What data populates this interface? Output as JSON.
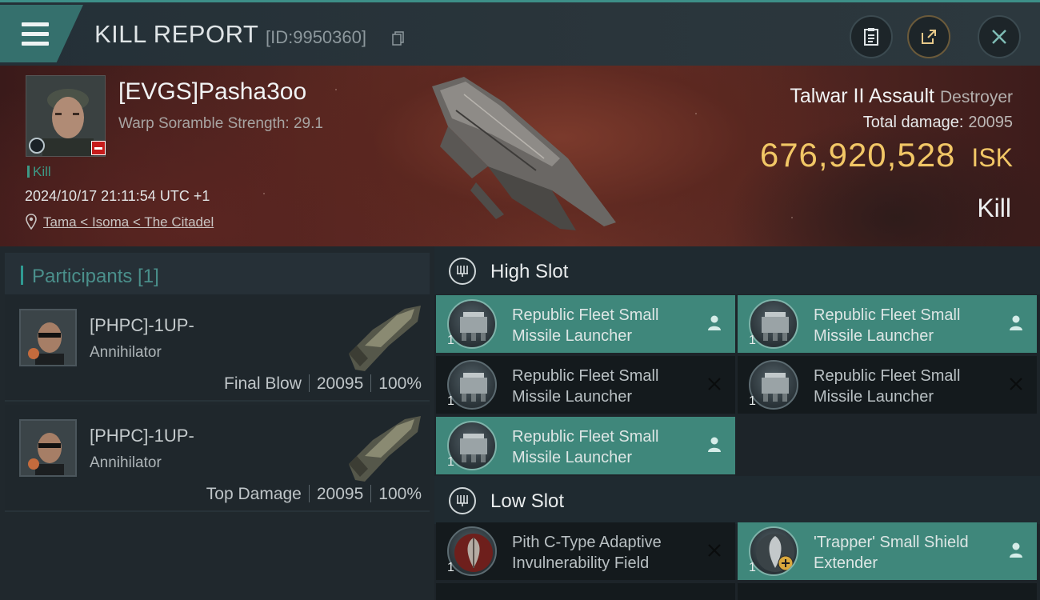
{
  "header": {
    "title": "KILL REPORT",
    "report_id": "[ID:9950360]"
  },
  "victim": {
    "name": "[EVGS]Pasha3oo",
    "subtitle": "Warp Soramble Strength: 29.1",
    "tag": "Kill",
    "datetime": "2024/10/17 21:11:54 UTC +1",
    "location": "Tama < Isoma < The Citadel"
  },
  "ship": {
    "name": "Talwar II Assault",
    "class": "Destroyer",
    "total_damage_label": "Total damage:",
    "total_damage": "20095",
    "isk_value": "676,920,528",
    "isk_unit": "ISK",
    "result": "Kill"
  },
  "participants": {
    "title": "Participants [1]",
    "rows": [
      {
        "name": "[PHPC]-1UP-",
        "ship": "Annihilator",
        "role": "Final Blow",
        "damage": "20095",
        "percent": "100%"
      },
      {
        "name": "[PHPC]-1UP-",
        "ship": "Annihilator",
        "role": "Top Damage",
        "damage": "20095",
        "percent": "100%"
      }
    ]
  },
  "fitting": {
    "high_slot": {
      "title": "High Slot",
      "modules": [
        {
          "line1": "Republic Fleet Small",
          "line2": "Missile Launcher",
          "qty": "1",
          "state": "active"
        },
        {
          "line1": "Republic Fleet Small",
          "line2": "Missile Launcher",
          "qty": "1",
          "state": "active"
        },
        {
          "line1": "Republic Fleet Small",
          "line2": "Missile Launcher",
          "qty": "1",
          "state": "destroyed"
        },
        {
          "line1": "Republic Fleet Small",
          "line2": "Missile Launcher",
          "qty": "1",
          "state": "destroyed"
        },
        {
          "line1": "Republic Fleet Small",
          "line2": "Missile Launcher",
          "qty": "1",
          "state": "active"
        }
      ]
    },
    "low_slot": {
      "title": "Low Slot",
      "modules": [
        {
          "line1": "Pith C-Type Adaptive",
          "line2": "Invulnerability Field",
          "qty": "1",
          "state": "destroyed"
        },
        {
          "line1": "'Trapper' Small Shield",
          "line2": "Extender",
          "qty": "1",
          "state": "active"
        }
      ]
    }
  },
  "colors": {
    "accent": "#3f877b",
    "isk": "#f2c766",
    "negative": "#c61b1b"
  },
  "icons": [
    "menu-icon",
    "copy-icon",
    "clipboard-icon",
    "share-icon",
    "close-icon",
    "location-icon",
    "slot-icon",
    "pilot-icon",
    "x-icon"
  ]
}
